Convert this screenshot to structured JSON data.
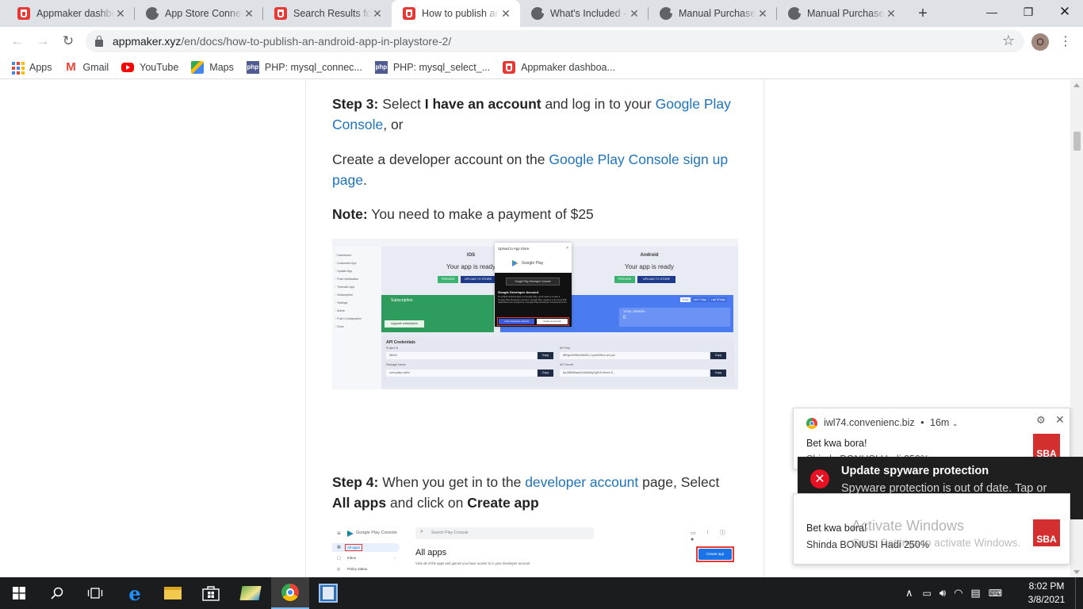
{
  "tabs": [
    {
      "title": "Appmaker dashbo",
      "favicon": "appmaker-icon",
      "active": false
    },
    {
      "title": "App Store Connec",
      "favicon": "apple-icon",
      "active": false
    },
    {
      "title": "Search Results for",
      "favicon": "appmaker-icon",
      "active": false
    },
    {
      "title": "How to publish an",
      "favicon": "appmaker-icon",
      "active": true
    },
    {
      "title": "What's Included -",
      "favicon": "apple-icon",
      "active": false
    },
    {
      "title": "Manual Purchase -",
      "favicon": "apple-icon",
      "active": false
    },
    {
      "title": "Manual Purchase -",
      "favicon": "apple-icon",
      "active": false
    }
  ],
  "address_bar": {
    "host": "appmaker.xyz",
    "path": "/en/docs/how-to-publish-an-android-app-in-playstore-2/",
    "profile_initial": "O"
  },
  "bookmarks": [
    {
      "label": "Apps",
      "icon": "apps-grid-icon"
    },
    {
      "label": "Gmail",
      "icon": "gmail-icon"
    },
    {
      "label": "YouTube",
      "icon": "youtube-icon"
    },
    {
      "label": "Maps",
      "icon": "maps-icon"
    },
    {
      "label": "PHP: mysql_connec...",
      "icon": "php-icon"
    },
    {
      "label": "PHP: mysql_select_...",
      "icon": "php-icon"
    },
    {
      "label": "Appmaker dashboa...",
      "icon": "appmaker-icon"
    }
  ],
  "article": {
    "step3": {
      "lead": "Step 3:",
      "t1": " Select ",
      "bold": "I have an account",
      "t2": " and log in to your ",
      "link": "Google Play Console",
      "t3": ", or"
    },
    "create": {
      "t1": "Create a developer account on the ",
      "link": "Google Play Console sign up page",
      "t2": "."
    },
    "note": {
      "lead": "Note:",
      "text": " You need to make a payment of $25"
    },
    "step4": {
      "lead": "Step 4:",
      "t1": " When you get in to the ",
      "link": "developer account",
      "t2": " page, Select ",
      "b1": "All apps",
      "t3": "  and click on ",
      "b2": "Create app"
    }
  },
  "screenshot1": {
    "sidebar": [
      "Dashboard",
      "Customize App",
      "Update App",
      "Push Notification",
      "Thematic App",
      "Subscription",
      "Settings",
      "Admin",
      "Push Configuration",
      "Docs"
    ],
    "ios_label": "iOS",
    "android_label": "Android",
    "ready_text": "Your app is ready",
    "preview": "PREVIEW",
    "upload_store": "UPLOAD TO STORE",
    "modal_title": "Upload to App Store",
    "google_play": "Google Play",
    "play_console": "Google Play Developer Console",
    "dev_account_title": "Google Developer Account",
    "dev_account_text": "To publish Android apps on Google Play, you'll need to create a Google Play Developer account. Google Play requires a one-time $25 registration fee charged by a Google Play Developer Console account.",
    "have_account_btn": "I have developer account",
    "create_account_btn": "Create an account",
    "subscription": "Subscription",
    "upgrade": "Upgrade subscription",
    "total_orders": "TOTAL ORDERS",
    "total_orders_value": "0",
    "filters": [
      "Today",
      "Last 7 days",
      "Last 30 days"
    ],
    "api_credentials": "API Credentials",
    "project_id": "Project Id",
    "project_id_value": "58442",
    "api_key": "API Key",
    "api_key_value": "8ff2ge3e9f5e496d93-1-yeetl3bf1e-a4-yzk",
    "package_name": "Package Name",
    "package_value": "com.yellyo.aibtv",
    "api_secret": "API Secret",
    "api_secret_value": "fpc3NB5ihsyh2v6ds6t4y7g9h7m4mnr-9_",
    "copy": "Copy"
  },
  "screenshot2": {
    "brand": "Google Play Console",
    "search_placeholder": "Search Play Console",
    "nav": [
      "All apps",
      "Inbox",
      "Policy status"
    ],
    "heading": "All apps",
    "subtext": "View all of the apps and games you have access to in your developer account",
    "create_btn": "Create app"
  },
  "chrome_notification": {
    "domain": "iwl74.convenienc.biz",
    "time": "16m",
    "title": "Bet kwa bora!",
    "partial": "Shinda BONUSI Hadi 250%",
    "badge": "SBA"
  },
  "defender_toast": {
    "title": "Update spyware protection",
    "body": "Spyware protection is out of date. Tap or click to update Windows Defender."
  },
  "second_notification": {
    "title": "Bet kwa bora!",
    "body": "Shinda BONUSI Hadi 250%",
    "badge": "SBA"
  },
  "watermark": {
    "line1": "Activate Windows",
    "line2": "Go to Settings to activate Windows."
  },
  "clock": {
    "time": "8:02 PM",
    "date": "3/8/2021"
  },
  "colors": {
    "link": "#1e73be",
    "accent": "#e81123",
    "toast_bg": "#1f1f1f",
    "taskbar_bg": "#1b1c1e"
  }
}
